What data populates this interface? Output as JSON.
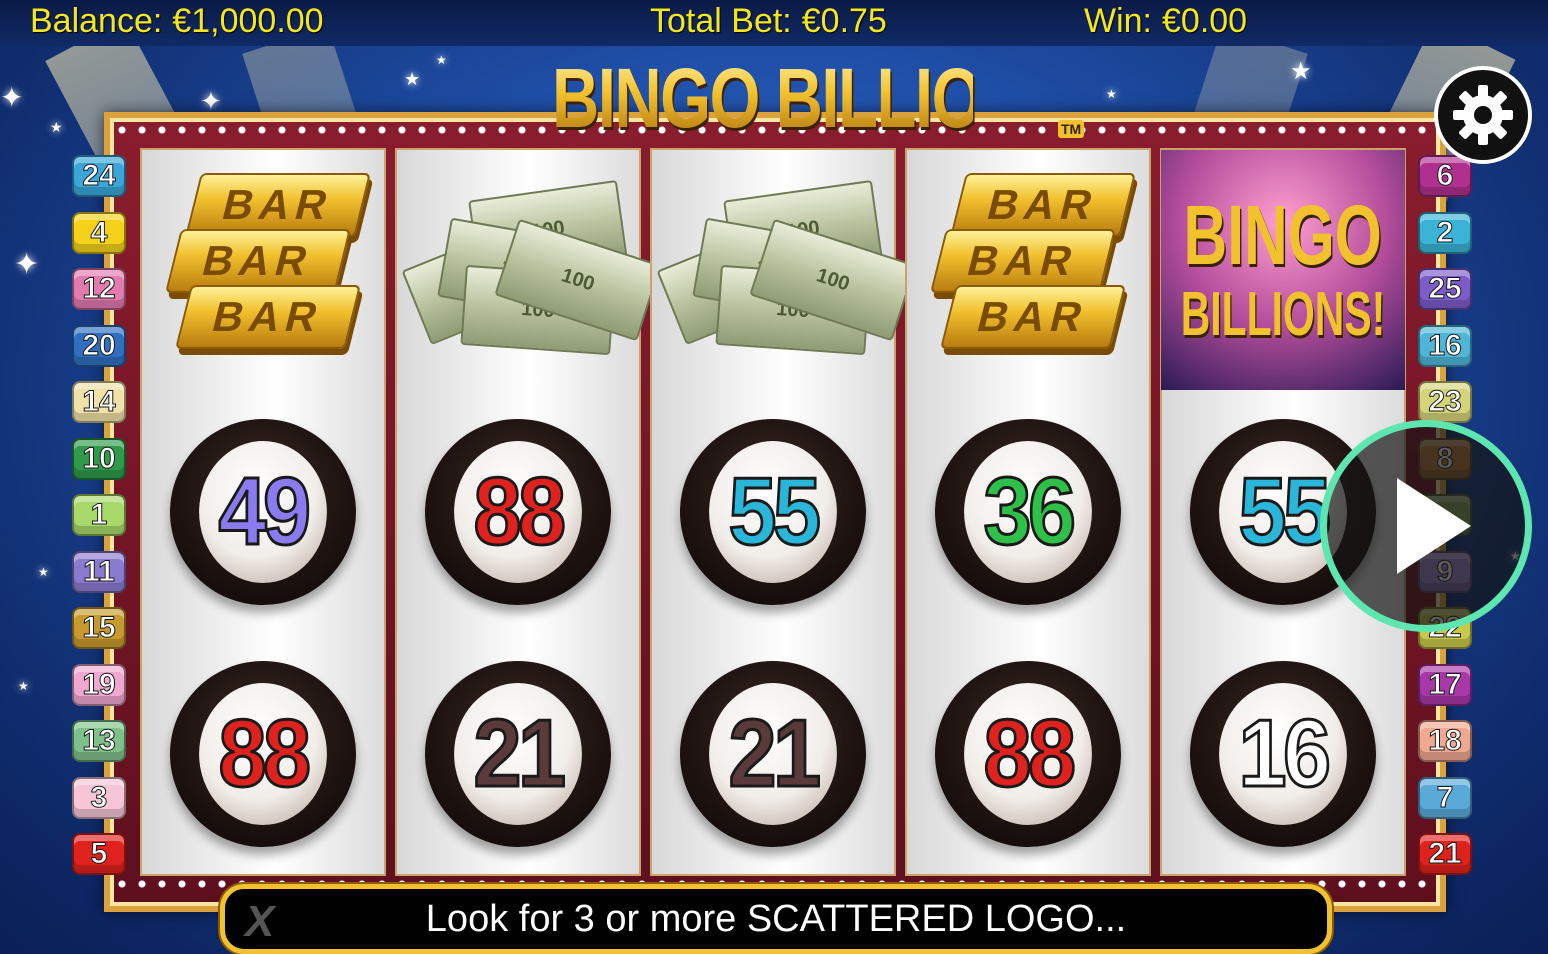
{
  "header": {
    "balance_label": "Balance:",
    "balance_value": "€1,000.00",
    "total_bet_label": "Total Bet:",
    "total_bet_value": "€0.75",
    "win_label": "Win:",
    "win_value": "€0.00"
  },
  "game": {
    "logo_text": "BINGO BILLIONS!",
    "trademark": "TM"
  },
  "left_numbers": [
    {
      "n": "24",
      "color": "#3aa7d8"
    },
    {
      "n": "4",
      "color": "#f5d21a"
    },
    {
      "n": "12",
      "color": "#e27bb0"
    },
    {
      "n": "20",
      "color": "#2f6fc0"
    },
    {
      "n": "14",
      "color": "#efe1a8"
    },
    {
      "n": "10",
      "color": "#2e9a4a"
    },
    {
      "n": "1",
      "color": "#a8d86a"
    },
    {
      "n": "11",
      "color": "#8a7bd0"
    },
    {
      "n": "15",
      "color": "#c79a2e"
    },
    {
      "n": "19",
      "color": "#f0a8d0"
    },
    {
      "n": "13",
      "color": "#7fc08a"
    },
    {
      "n": "3",
      "color": "#f6c6d6"
    },
    {
      "n": "5",
      "color": "#e0221e"
    }
  ],
  "right_numbers": [
    {
      "n": "6",
      "color": "#b0308f"
    },
    {
      "n": "2",
      "color": "#3ab3d6"
    },
    {
      "n": "25",
      "color": "#7c5cc8"
    },
    {
      "n": "16",
      "color": "#4fb6d8"
    },
    {
      "n": "23",
      "color": "#d6d47a"
    },
    {
      "n": "8",
      "color": "#b87a3a"
    },
    {
      "n": "",
      "color": "#8aa85a"
    },
    {
      "n": "9",
      "color": "#a08ad8"
    },
    {
      "n": "22",
      "color": "#c8c84a"
    },
    {
      "n": "17",
      "color": "#a838a8"
    },
    {
      "n": "18",
      "color": "#f0a890"
    },
    {
      "n": "7",
      "color": "#5aaad8"
    },
    {
      "n": "21",
      "color": "#e0221e"
    }
  ],
  "reels": [
    {
      "symbols": [
        {
          "type": "gold-bars",
          "text": "BAR"
        },
        {
          "type": "ball",
          "value": "49",
          "color": "#8a7bf0"
        },
        {
          "type": "ball",
          "value": "88",
          "color": "#e0221e"
        }
      ]
    },
    {
      "symbols": [
        {
          "type": "cash",
          "text": "100"
        },
        {
          "type": "ball",
          "value": "88",
          "color": "#e0221e"
        },
        {
          "type": "ball",
          "value": "21",
          "color": "#5a3a3a"
        }
      ]
    },
    {
      "symbols": [
        {
          "type": "cash",
          "text": "100"
        },
        {
          "type": "ball",
          "value": "55",
          "color": "#2ab6d8"
        },
        {
          "type": "ball",
          "value": "21",
          "color": "#5a3a3a"
        }
      ]
    },
    {
      "symbols": [
        {
          "type": "gold-bars",
          "text": "BAR"
        },
        {
          "type": "ball",
          "value": "36",
          "color": "#2fc04a"
        },
        {
          "type": "ball",
          "value": "88",
          "color": "#e0221e"
        }
      ]
    },
    {
      "symbols": [
        {
          "type": "bingo-logo",
          "line1": "BINGO",
          "line2": "BILLIONS!"
        },
        {
          "type": "ball",
          "value": "55",
          "color": "#2ab6d8"
        },
        {
          "type": "ball",
          "value": "16",
          "color": "#ffffff"
        }
      ]
    }
  ],
  "controls": {
    "settings_icon": "gear-icon",
    "spin_icon": "play-icon",
    "accent_color": "#5ee6b0"
  },
  "message": {
    "text": "Look for 3 or more SCATTERED LOGO...",
    "brand_mark": "X"
  }
}
